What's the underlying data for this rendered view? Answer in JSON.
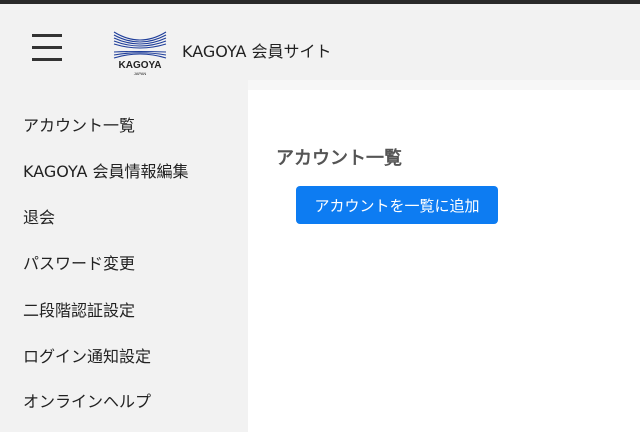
{
  "header": {
    "menu_icon": "hamburger-menu-icon",
    "logo": {
      "word": "KAGOYA",
      "sub": "JAPAN"
    },
    "site_title": "KAGOYA 会員サイト"
  },
  "sidebar": {
    "items": [
      {
        "label": "アカウント一覧"
      },
      {
        "label": "KAGOYA 会員情報編集"
      },
      {
        "label": "退会"
      },
      {
        "label": "パスワード変更"
      },
      {
        "label": "二段階認証設定"
      },
      {
        "label": "ログイン通知設定"
      },
      {
        "label": "オンラインヘルプ"
      }
    ]
  },
  "main": {
    "page_title": "アカウント一覧",
    "add_button_label": "アカウントを一覧に追加"
  },
  "colors": {
    "header_bg": "#f2f2f2",
    "sidebar_bg": "#f2f2f2",
    "button_bg": "#0d7cf2",
    "logo_blue": "#1f3e9a"
  }
}
